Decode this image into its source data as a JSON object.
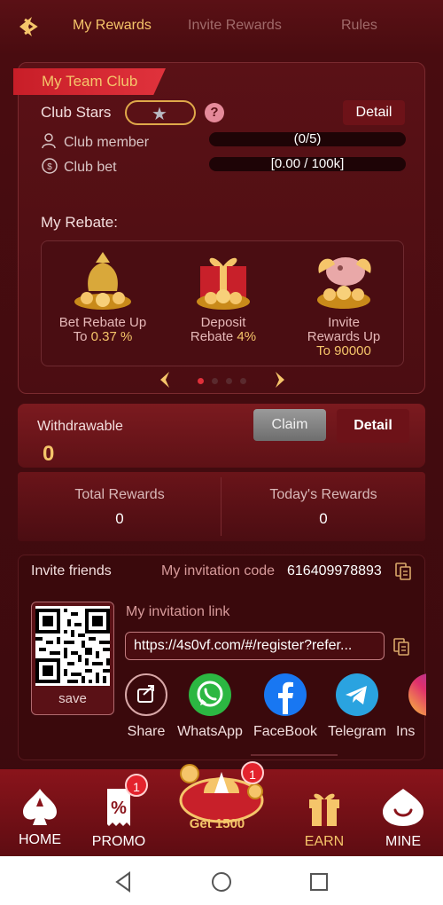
{
  "tabs": [
    {
      "label": "My Rewards",
      "active": true
    },
    {
      "label": "Invite Rewards",
      "active": false
    },
    {
      "label": "Rules",
      "active": false
    }
  ],
  "club": {
    "title": "My Team Club",
    "stars_label": "Club Stars",
    "stars_count": 1,
    "help": "?",
    "detail_label": "Detail",
    "member_label": "Club member",
    "member_value": "(0/5)",
    "bet_label": "Club bet",
    "bet_value": "[0.00 / 100k]",
    "rebate_label": "My Rebate:",
    "rebates": [
      {
        "line1": "Bet Rebate Up",
        "line2a": "To ",
        "line2b": "0.37 %",
        "line3": ""
      },
      {
        "line1": "Deposit",
        "line2a": "Rebate ",
        "line2b": "4%",
        "line3": ""
      },
      {
        "line1": "Invite",
        "line2a": "Rewards Up",
        "line2b": "",
        "line3": "To 90000"
      }
    ],
    "page_count": 4,
    "active_page": 1
  },
  "withdraw": {
    "label": "Withdrawable",
    "value": "0",
    "claim_label": "Claim",
    "detail_label": "Detail"
  },
  "totals": {
    "total_label": "Total Rewards",
    "total_value": "0",
    "today_label": "Today's Rewards",
    "today_value": "0"
  },
  "invite": {
    "friends_label": "Invite friends",
    "code_label": "My invitation code",
    "code_value": "616409978893",
    "save_label": "save",
    "link_label": "My invitation link",
    "link_value": "https://4s0vf.com/#/register?refer...",
    "share": [
      {
        "label": "Share",
        "icon": "share-icon"
      },
      {
        "label": "WhatsApp",
        "icon": "whatsapp-icon"
      },
      {
        "label": "FaceBook",
        "icon": "facebook-icon"
      },
      {
        "label": "Telegram",
        "icon": "telegram-icon"
      },
      {
        "label": "Ins",
        "icon": "instagram-icon"
      }
    ]
  },
  "nav": {
    "home": "HOME",
    "promo": "PROMO",
    "promo_badge": "1",
    "center": "Get 1500",
    "center_badge": "1",
    "earn": "EARN",
    "mine": "MINE"
  },
  "colors": {
    "accent_gold": "#f5c56a",
    "background": "#4a0c10",
    "badge_red": "#e3232d"
  }
}
